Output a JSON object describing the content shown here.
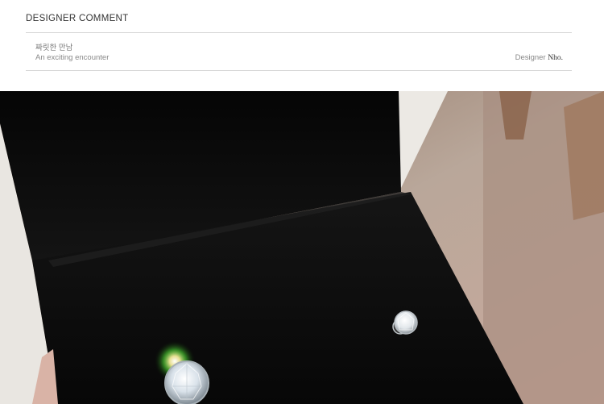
{
  "comment": {
    "heading": "DESIGNER COMMENT",
    "title_ko": "짜릿한 만남",
    "title_en": "An exciting encounter",
    "designer_prefix": "Designer",
    "designer_name": "Nho."
  },
  "photo": {
    "subject": "earring-box-photo",
    "colors": {
      "velvet": "#0b0b0b",
      "box_white": "#ece9e4",
      "background_beige": "#b9a79a"
    }
  }
}
